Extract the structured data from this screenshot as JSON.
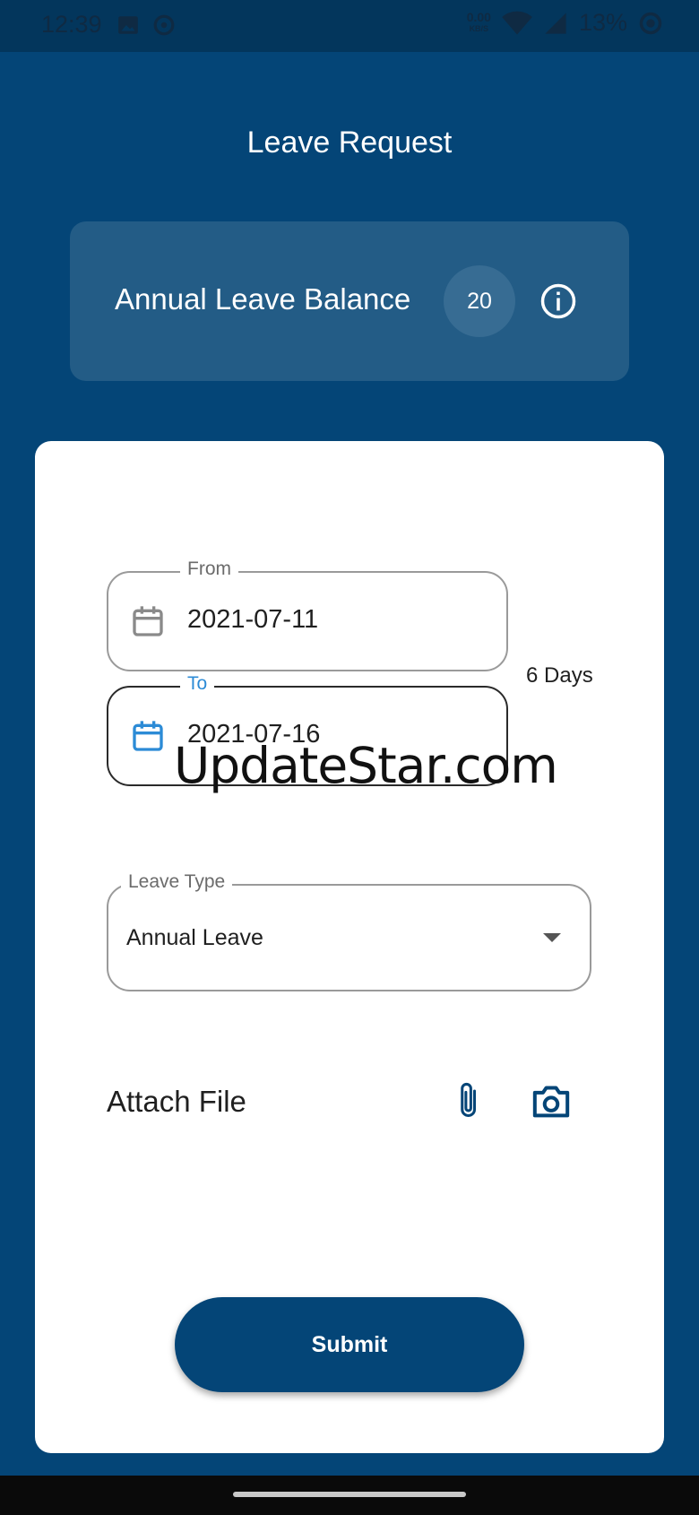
{
  "status_bar": {
    "time": "12:39",
    "net_speed_value": "0.00",
    "net_speed_unit": "KB/S",
    "battery": "13%",
    "icons": [
      "image-icon",
      "sync-icon",
      "wifi-icon",
      "signal-icon",
      "battery-icon"
    ]
  },
  "header": {
    "title": "Leave Request"
  },
  "balance": {
    "label": "Annual Leave Balance",
    "count": "20",
    "info_icon": "info-icon"
  },
  "form": {
    "from": {
      "label": "From",
      "value": "2021-07-11"
    },
    "to": {
      "label": "To",
      "value": "2021-07-16"
    },
    "days": "6 Days",
    "leave_type": {
      "label": "Leave Type",
      "value": "Annual Leave"
    },
    "attach_label": "Attach File",
    "submit_label": "Submit"
  },
  "watermark": "UpdateStar.com",
  "colors": {
    "primary": "#044577",
    "accent": "#2c8bd6",
    "card": "#235c86"
  }
}
